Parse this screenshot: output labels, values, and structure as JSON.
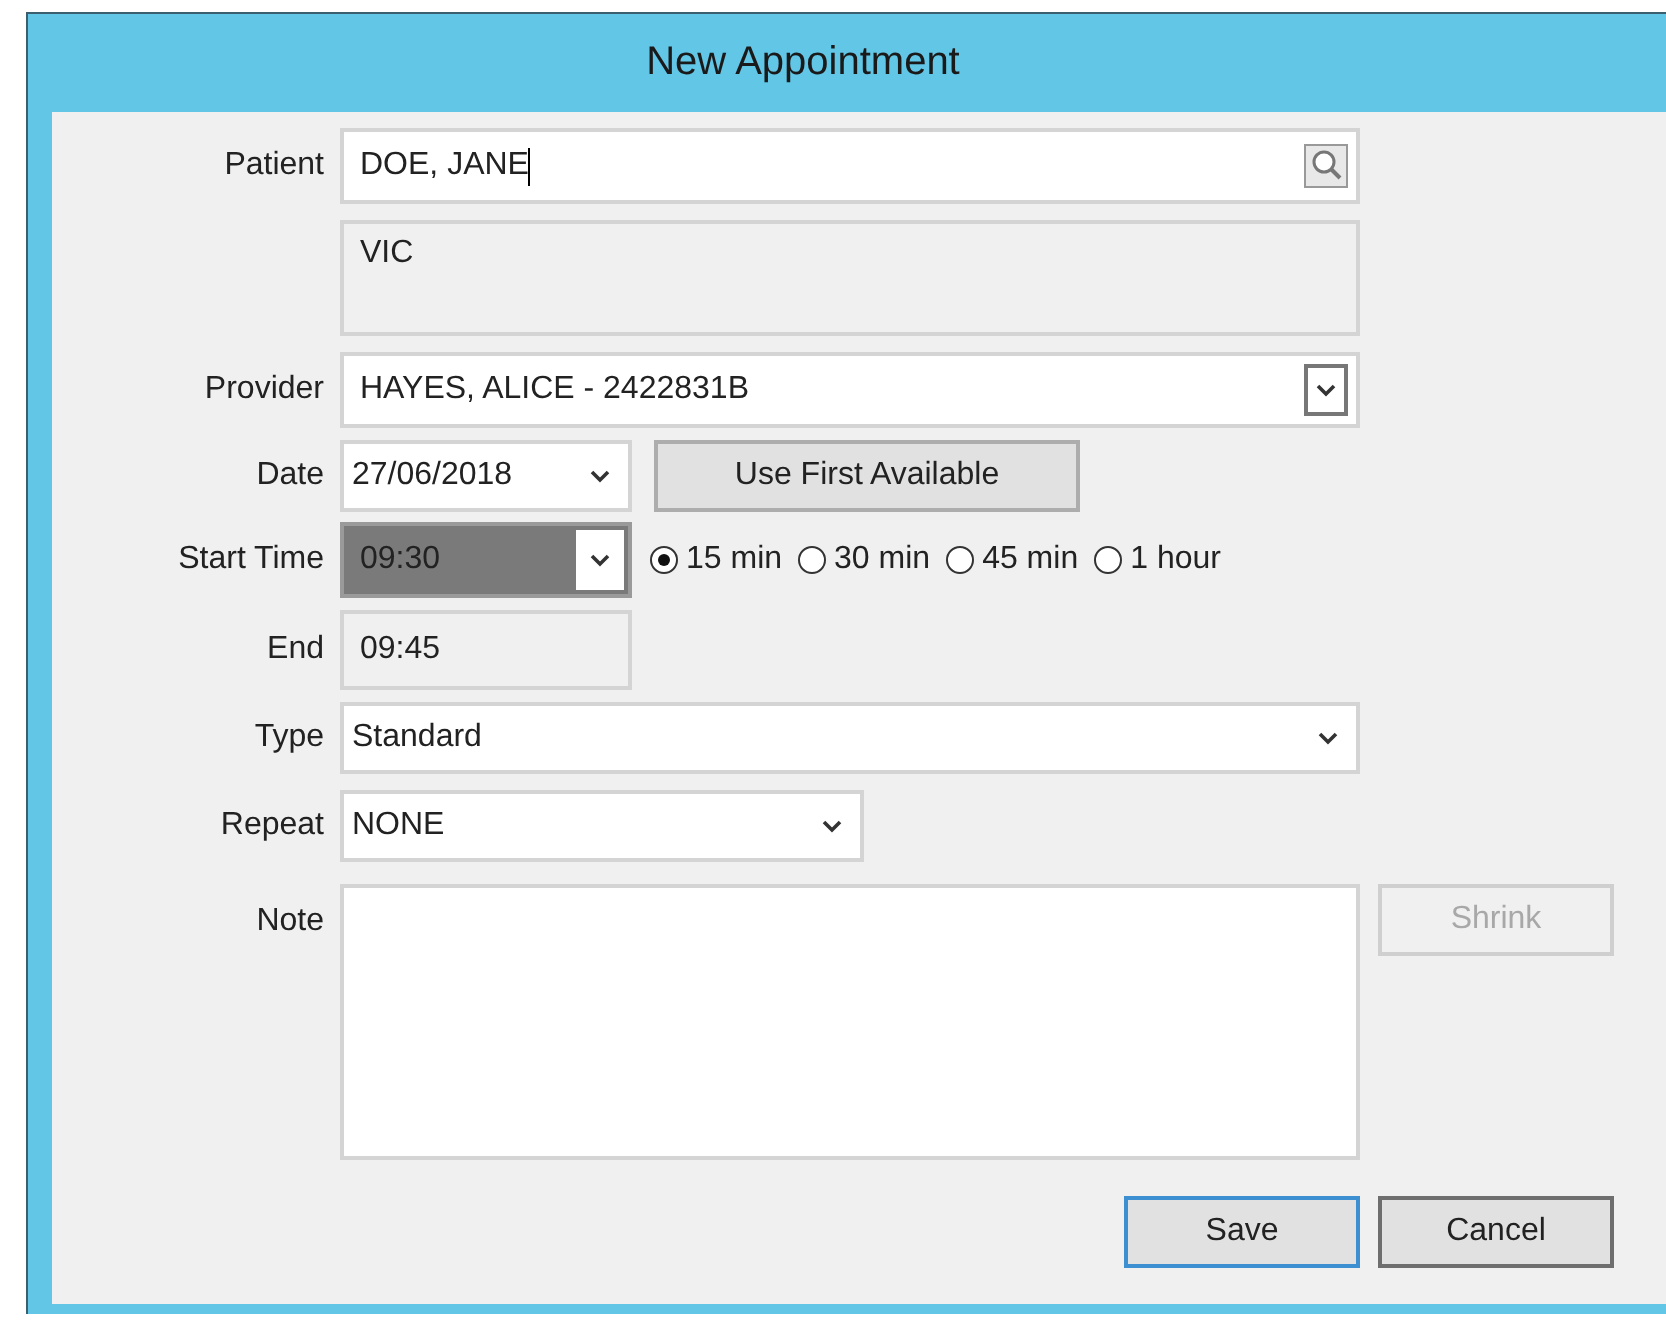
{
  "window": {
    "title": "New Appointment"
  },
  "patient": {
    "label": "Patient",
    "value": "DOE, JANE"
  },
  "address": {
    "value": "VIC"
  },
  "provider": {
    "label": "Provider",
    "value": "HAYES, ALICE - 2422831B"
  },
  "date": {
    "label": "Date",
    "value": "27/06/2018"
  },
  "first_available": {
    "label": "Use First Available"
  },
  "start_time": {
    "label": "Start Time",
    "value": "09:30",
    "highlighted": true
  },
  "durations": [
    {
      "label": "15 min",
      "selected": true
    },
    {
      "label": "30 min",
      "selected": false
    },
    {
      "label": "45 min",
      "selected": false
    },
    {
      "label": "1 hour",
      "selected": false
    }
  ],
  "end": {
    "label": "End",
    "value": "09:45"
  },
  "type": {
    "label": "Type",
    "value": "Standard"
  },
  "repeat": {
    "label": "Repeat",
    "value": "NONE"
  },
  "note": {
    "label": "Note"
  },
  "shrink": {
    "label": "Shrink",
    "disabled": true
  },
  "buttons": [
    {
      "label": "Save",
      "default": true
    },
    {
      "label": "Cancel",
      "default": false
    }
  ]
}
